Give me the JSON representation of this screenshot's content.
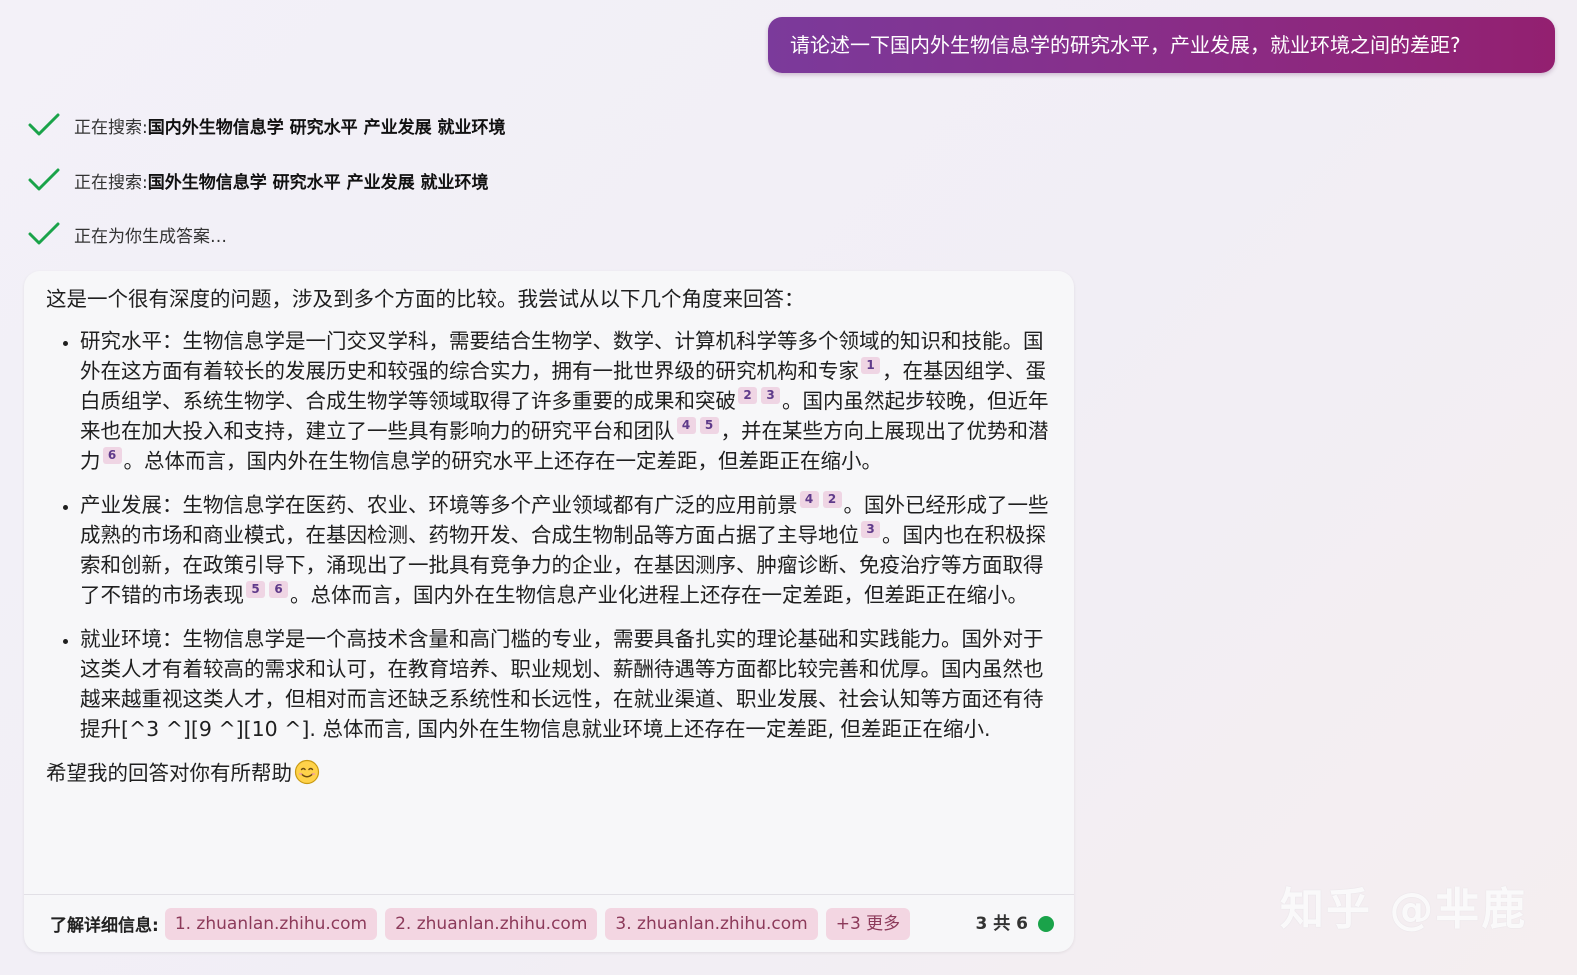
{
  "user_message": "请论述一下国内外生物信息学的研究水平，产业发展，就业环境之间的差距?",
  "steps": [
    {
      "prefix": "正在搜索: ",
      "query": "国内外生物信息学 研究水平 产业发展 就业环境"
    },
    {
      "prefix": "正在搜索: ",
      "query": "国外生物信息学 研究水平 产业发展 就业环境"
    },
    {
      "prefix": "正在为你生成答案…",
      "query": ""
    }
  ],
  "answer": {
    "intro": "这是一个很有深度的问题，涉及到多个方面的比较。我尝试从以下几个角度来回答：",
    "p1": {
      "t1": "研究水平：生物信息学是一门交叉学科，需要结合生物学、数学、计算机科学等多个领域的知识和技能。国外在这方面有着较长的发展历史和较强的综合实力，拥有一批世界级的研究机构和专家",
      "c1": "1",
      "t2": "，在基因组学、蛋白质组学、系统生物学、合成生物学等领域取得了许多重要的成果和突破",
      "c2": "2",
      "c3": "3",
      "t3": "。国内虽然起步较晚，但近年来也在加大投入和支持，建立了一些具有影响力的研究平台和团队",
      "c4": "4",
      "c5": "5",
      "t4": "，并在某些方向上展现出了优势和潜力",
      "c6": "6",
      "t5": "。总体而言，国内外在生物信息学的研究水平上还存在一定差距，但差距正在缩小。"
    },
    "p2": {
      "t1": "产业发展：生物信息学在医药、农业、环境等多个产业领域都有广泛的应用前景",
      "c1": "4",
      "c2": "2",
      "t2": "。国外已经形成了一些成熟的市场和商业模式，在基因检测、药物开发、合成生物制品等方面占据了主导地位",
      "c3": "3",
      "t3": "。国内也在积极探索和创新，在政策引导下，涌现出了一批具有竞争力的企业，在基因测序、肿瘤诊断、免疫治疗等方面取得了不错的市场表现",
      "c4": "5",
      "c5": "6",
      "t4": "。总体而言，国内外在生物信息产业化进程上还存在一定差距，但差距正在缩小。"
    },
    "p3": {
      "t1": "就业环境：生物信息学是一个高技术含量和高门槛的专业，需要具备扎实的理论基础和实践能力。国外对于这类人才有着较高的需求和认可，在教育培养、职业规划、薪酬待遇等方面都比较完善和优厚。国内虽然也越来越重视这类人才，但相对而言还缺乏系统性和长远性，在就业渠道、职业发展、社会认知等方面还有待提升[^3 ^][9 ^][10 ^]. 总体而言, 国内外在生物信息就业环境上还存在一定差距, 但差距正在缩小."
    },
    "closing": "希望我的回答对你有所帮助"
  },
  "footer": {
    "learn_more_label": "了解详细信息:",
    "sources": [
      "1. zhuanlan.zhihu.com",
      "2. zhuanlan.zhihu.com",
      "3. zhuanlan.zhihu.com"
    ],
    "more_label": "+3 更多",
    "turn_counter": "3 共 6"
  },
  "colors": {
    "user_bubble": "#8a2c86",
    "check": "#1aa34a",
    "citation_bg": "#efd5e4",
    "status_dot": "#1aa34a"
  },
  "icons": {
    "step_status": "check-icon",
    "emoji": "smiling-face-icon"
  },
  "watermark": "知乎 @芈鹿"
}
